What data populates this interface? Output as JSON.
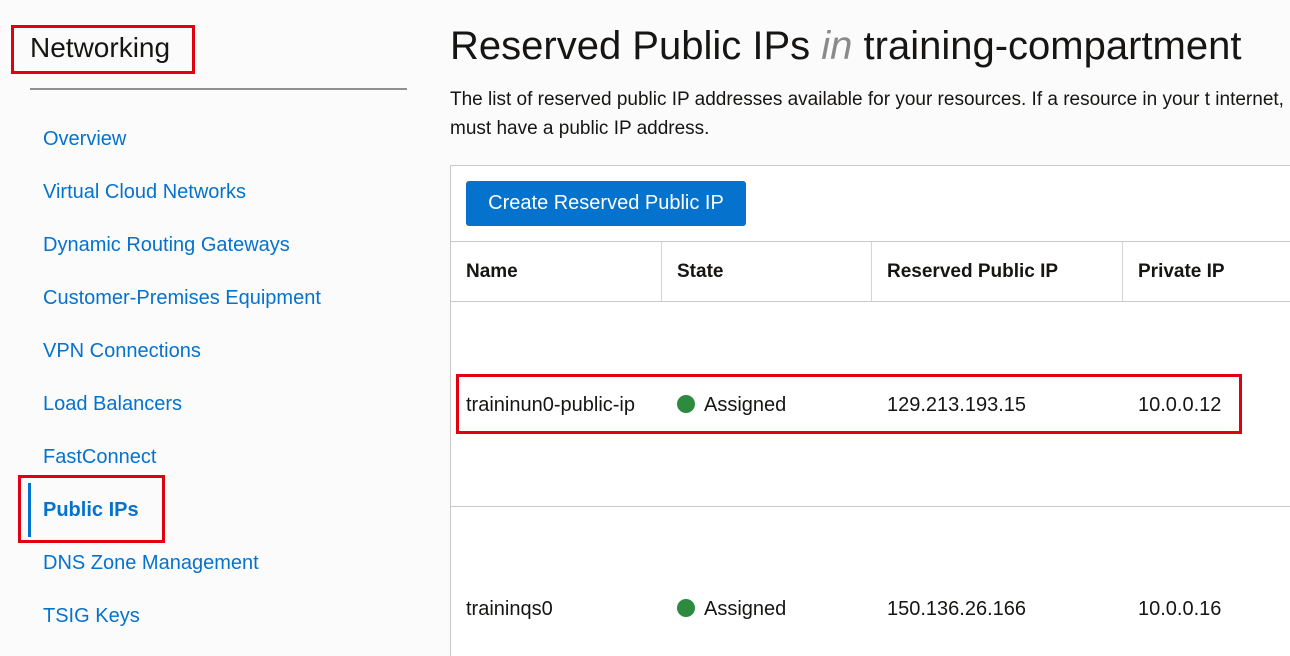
{
  "sidebar": {
    "title": "Networking",
    "items": [
      {
        "label": "Overview"
      },
      {
        "label": "Virtual Cloud Networks"
      },
      {
        "label": "Dynamic Routing Gateways"
      },
      {
        "label": "Customer-Premises Equipment"
      },
      {
        "label": "VPN Connections"
      },
      {
        "label": "Load Balancers"
      },
      {
        "label": "FastConnect"
      },
      {
        "label": "Public IPs",
        "active": true
      },
      {
        "label": "DNS Zone Management"
      },
      {
        "label": "TSIG Keys"
      }
    ]
  },
  "main": {
    "title_part1": "Reserved Public IPs",
    "title_in": "in",
    "title_part2": "training-compartment",
    "description": "The list of reserved public IP addresses available for your resources. If a resource in your t internet, it must have a public IP address.",
    "create_button": "Create Reserved Public IP",
    "table": {
      "columns": [
        "Name",
        "State",
        "Reserved Public IP",
        "Private IP"
      ],
      "rows": [
        {
          "name": "traininun0-public-ip",
          "state": "Assigned",
          "public_ip": "129.213.193.15",
          "private_ip": "10.0.0.12"
        },
        {
          "name": "traininqs0",
          "state": "Assigned",
          "public_ip": "150.136.26.166",
          "private_ip": "10.0.0.16"
        }
      ]
    }
  },
  "colors": {
    "accent": "#0572ce",
    "status_assigned": "#2d8a3e",
    "annotation": "#e1000f"
  }
}
